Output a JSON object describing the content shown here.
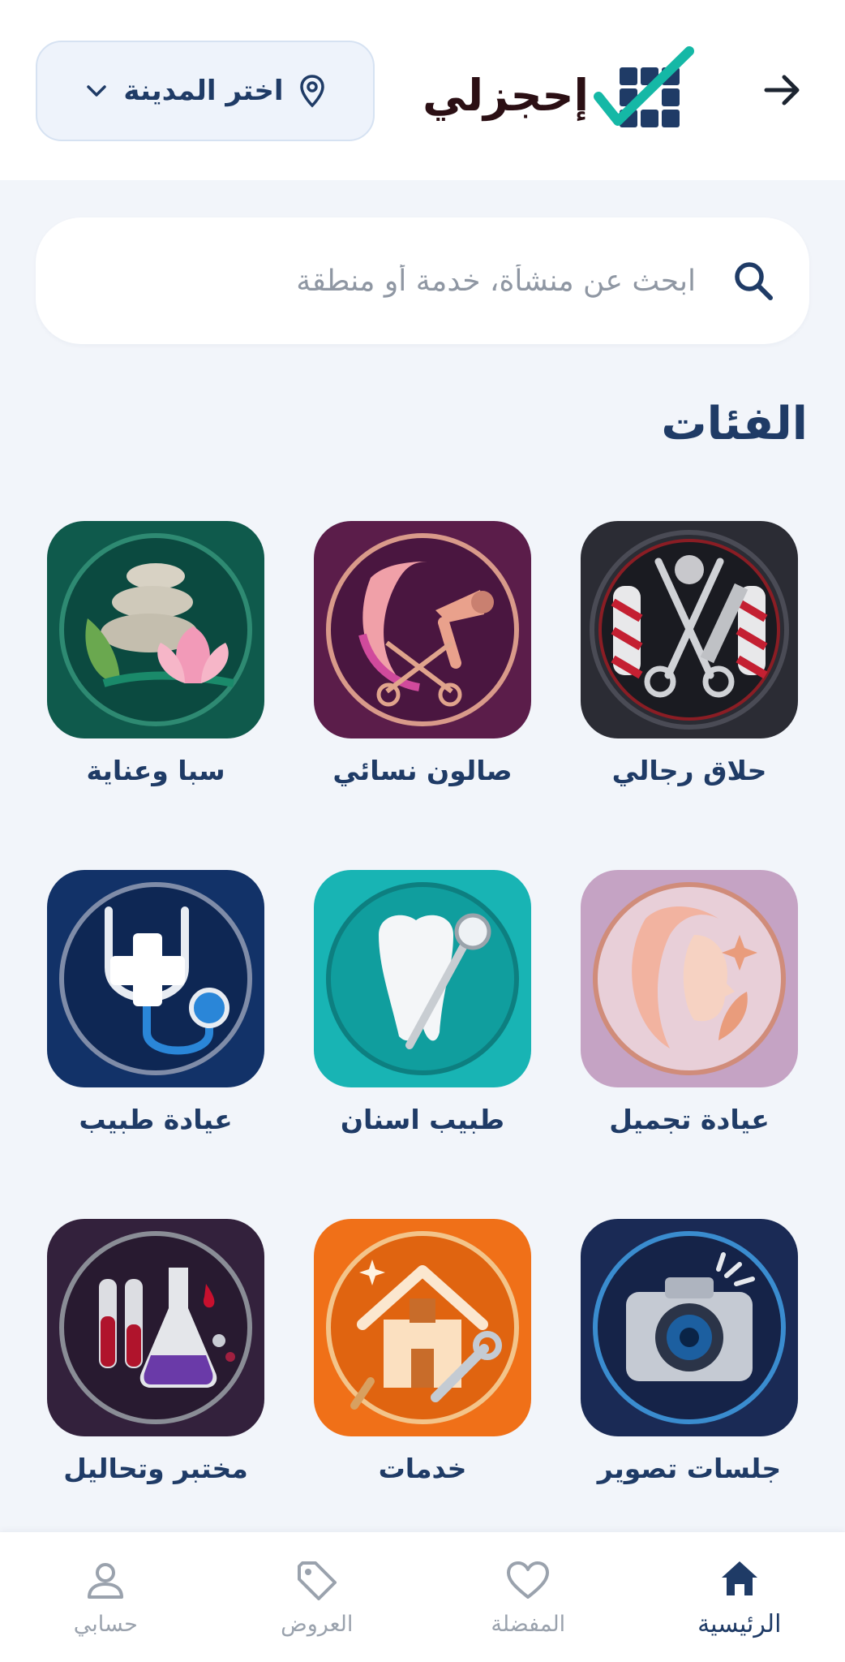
{
  "header": {
    "app_name": "إحجزلي",
    "city_select_label": "اختر المدينة"
  },
  "search": {
    "placeholder": "ابحث عن منشأة، خدمة أو منطقة"
  },
  "categories_title": "الفئات",
  "categories": [
    {
      "label": "حلاق رجالي",
      "icon": "barber-icon",
      "bg": "#2b2c34"
    },
    {
      "label": "صالون نسائي",
      "icon": "salon-icon",
      "bg": "#5b1d4a"
    },
    {
      "label": "سبا وعناية",
      "icon": "spa-icon",
      "bg": "#0f5a4c"
    },
    {
      "label": "عيادة تجميل",
      "icon": "beauty-clinic-icon",
      "bg": "#c5a3c4"
    },
    {
      "label": "طبيب اسنان",
      "icon": "dentist-icon",
      "bg": "#18b4b4"
    },
    {
      "label": "عيادة طبيب",
      "icon": "doctor-icon",
      "bg": "#123268"
    },
    {
      "label": "جلسات تصوير",
      "icon": "camera-icon",
      "bg": "#1a2a55"
    },
    {
      "label": "خدمات",
      "icon": "home-services-icon",
      "bg": "#f07018"
    },
    {
      "label": "مختبر وتحاليل",
      "icon": "lab-icon",
      "bg": "#33213c"
    }
  ],
  "bottom_nav": [
    {
      "label": "الرئيسية",
      "icon": "home-icon",
      "active": true
    },
    {
      "label": "المفضلة",
      "icon": "heart-icon",
      "active": false
    },
    {
      "label": "العروض",
      "icon": "tag-icon",
      "active": false
    },
    {
      "label": "حسابي",
      "icon": "user-icon",
      "active": false
    }
  ],
  "colors": {
    "primary": "#1f3b66",
    "background": "#f2f5fa",
    "accent_teal": "#15b8a6",
    "muted": "#9aa2ad"
  }
}
